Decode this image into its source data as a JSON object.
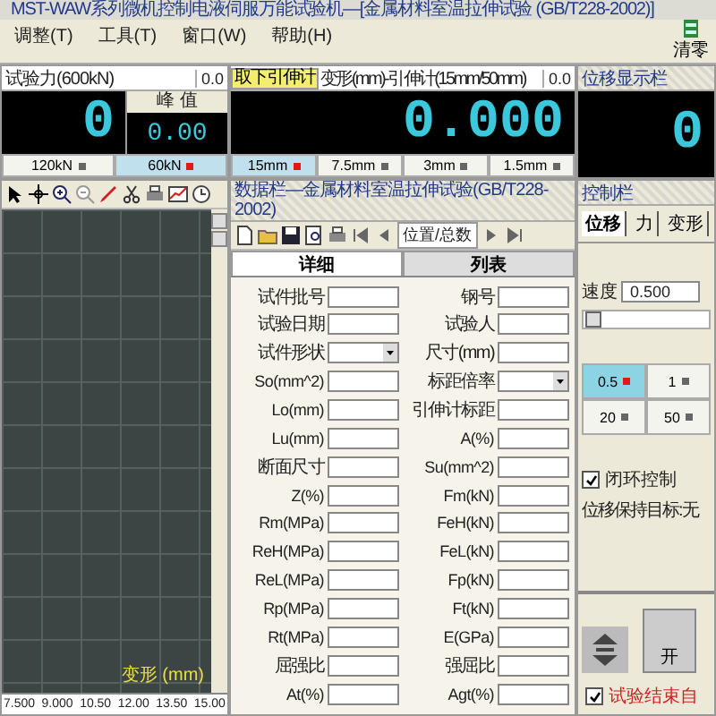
{
  "window": {
    "title": "MST-WAW系列微机控制电液伺服万能试验机—[金属材料室温拉伸试验 (GB/T228-2002)]"
  },
  "menu": [
    "调整(T)",
    "工具(T)",
    "窗口(W)",
    "帮助(H)"
  ],
  "toolbar": {
    "clear_button": "清零"
  },
  "force_panel": {
    "title": "试验力(600kN)",
    "reading": "0.0",
    "value": "0",
    "peak_label": "峰 值",
    "peak_value": "0.00",
    "ranges": [
      {
        "label": "120kN",
        "selected": false
      },
      {
        "label": "60kN",
        "selected": true
      }
    ]
  },
  "deformation_panel": {
    "button": "取下引伸计",
    "title": "变形(mm)-引伸计(15mm/50mm)",
    "reading": "0.0",
    "value": "0.000",
    "ranges": [
      {
        "label": "15mm",
        "selected": true
      },
      {
        "label": "7.5mm",
        "selected": false
      },
      {
        "label": "3mm",
        "selected": false
      },
      {
        "label": "1.5mm",
        "selected": false
      }
    ]
  },
  "displacement_panel": {
    "title": "位移显示栏",
    "value": "0"
  },
  "chart_panel": {
    "x_ticks": [
      "7.500",
      "9.000",
      "10.50",
      "12.00",
      "13.50",
      "15.00"
    ],
    "axis_label": "变形 (mm)"
  },
  "data_panel": {
    "title": "数据栏—金属材料室温拉伸试验(GB/T228-2002)",
    "nav_label": "位置/总数",
    "tabs": [
      {
        "label": "详细",
        "selected": true
      },
      {
        "label": "列表",
        "selected": false
      }
    ],
    "fields": [
      {
        "label": "试件批号",
        "kind": "text"
      },
      {
        "label": "钢号",
        "kind": "text"
      },
      {
        "label": "试验日期",
        "kind": "text"
      },
      {
        "label": "试验人",
        "kind": "text"
      },
      {
        "label": "试件形状",
        "kind": "select"
      },
      {
        "label": "尺寸(mm)",
        "kind": "text"
      },
      {
        "label": "So(mm^2)",
        "kind": "text"
      },
      {
        "label": "标距倍率",
        "kind": "select"
      },
      {
        "label": "Lo(mm)",
        "kind": "text"
      },
      {
        "label": "引伸计标距",
        "kind": "text"
      },
      {
        "label": "Lu(mm)",
        "kind": "text"
      },
      {
        "label": "A(%)",
        "kind": "text"
      },
      {
        "label": "断面尺寸",
        "kind": "text"
      },
      {
        "label": "Su(mm^2)",
        "kind": "text"
      },
      {
        "label": "Z(%)",
        "kind": "text"
      },
      {
        "label": "Fm(kN)",
        "kind": "text"
      },
      {
        "label": "Rm(MPa)",
        "kind": "text"
      },
      {
        "label": "FeH(kN)",
        "kind": "text"
      },
      {
        "label": "ReH(MPa)",
        "kind": "text"
      },
      {
        "label": "FeL(kN)",
        "kind": "text"
      },
      {
        "label": "ReL(MPa)",
        "kind": "text"
      },
      {
        "label": "Fp(kN)",
        "kind": "text"
      },
      {
        "label": "Rp(MPa)",
        "kind": "text"
      },
      {
        "label": "Ft(kN)",
        "kind": "text"
      },
      {
        "label": "Rt(MPa)",
        "kind": "text"
      },
      {
        "label": "E(GPa)",
        "kind": "text"
      },
      {
        "label": "屈强比",
        "kind": "text"
      },
      {
        "label": "强屈比",
        "kind": "text"
      },
      {
        "label": "At(%)",
        "kind": "text"
      },
      {
        "label": "Agt(%)",
        "kind": "text"
      }
    ]
  },
  "control_panel": {
    "title": "控制栏",
    "tabs": [
      {
        "label": "位移",
        "selected": true
      },
      {
        "label": "力",
        "selected": false
      },
      {
        "label": "变形",
        "selected": false
      }
    ],
    "speed_label": "速度",
    "speed_value": "0.500",
    "speed_slider": {
      "level": 0.05
    },
    "rates": [
      {
        "label": "0.5",
        "selected": true
      },
      {
        "label": "1",
        "selected": false
      },
      {
        "label": "20",
        "selected": false
      },
      {
        "label": "50",
        "selected": false
      }
    ],
    "closed_loop": {
      "label": "闭环控制",
      "checked": true
    },
    "hold_target": "位移保持目标:无",
    "start_button": "开",
    "auto_stop": {
      "label": "试验结束自",
      "checked": true
    }
  }
}
